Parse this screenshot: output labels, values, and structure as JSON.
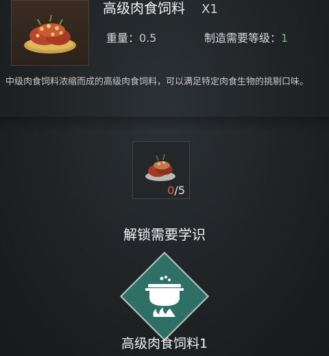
{
  "item": {
    "name": "高级肉食饲料",
    "quantity": "X1",
    "weight_label": "重量：",
    "weight_value": "0.5",
    "level_label": "制造需要等级：",
    "level_value": "1",
    "icon": "meat-feed-icon",
    "description": "中级肉食饲料浓缩而成的高级肉食饲料，可以满足特定肉食生物的挑剔口味。"
  },
  "ingredient": {
    "icon": "meat-feed-icon",
    "have": "0",
    "sep_need": "/5"
  },
  "unlock": {
    "title": "解锁需要学识",
    "icon": "cooking-pot-icon",
    "name": "高级肉食饲料1"
  },
  "colors": {
    "accent_green": "#6fbf73",
    "diamond_fill": "#2e6f66",
    "missing_red": "#e0604a"
  }
}
